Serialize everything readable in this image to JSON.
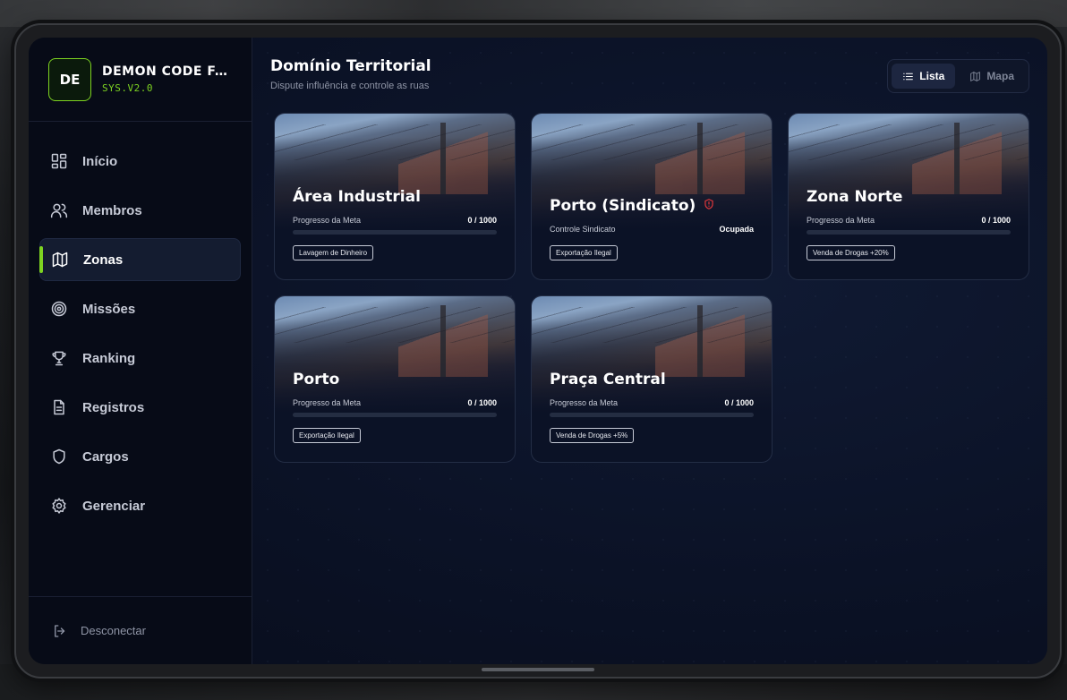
{
  "brand": {
    "logo_text": "DE",
    "name": "DEMON CODE FA...",
    "version": "SYS.V2.0",
    "accent_color": "#7dd321"
  },
  "sidebar": {
    "items": [
      {
        "label": "Início",
        "icon": "grid-icon",
        "active": false
      },
      {
        "label": "Membros",
        "icon": "users-icon",
        "active": false
      },
      {
        "label": "Zonas",
        "icon": "map-icon",
        "active": true
      },
      {
        "label": "Missões",
        "icon": "target-icon",
        "active": false
      },
      {
        "label": "Ranking",
        "icon": "trophy-icon",
        "active": false
      },
      {
        "label": "Registros",
        "icon": "document-icon",
        "active": false
      },
      {
        "label": "Cargos",
        "icon": "shield-icon",
        "active": false
      },
      {
        "label": "Gerenciar",
        "icon": "gear-icon",
        "active": false
      }
    ],
    "logout_label": "Desconectar"
  },
  "header": {
    "title": "Domínio Territorial",
    "subtitle": "Dispute influência e controle as ruas"
  },
  "view_toggle": {
    "list_label": "Lista",
    "map_label": "Mapa",
    "selected": "Lista"
  },
  "zones": [
    {
      "name": "Área Industrial",
      "status_label": "Progresso da Meta",
      "status_value": "0 / 1000",
      "progress": 0,
      "tag": "Lavagem de Dinheiro",
      "contested": false
    },
    {
      "name": "Porto (Sindicato)",
      "status_label": "Controle Sindicato",
      "status_value": "Ocupada",
      "progress": null,
      "tag": "Exportação Ilegal",
      "contested": true
    },
    {
      "name": "Zona Norte",
      "status_label": "Progresso da Meta",
      "status_value": "0 / 1000",
      "progress": 0,
      "tag": "Venda de Drogas +20%",
      "contested": false
    },
    {
      "name": "Porto",
      "status_label": "Progresso da Meta",
      "status_value": "0 / 1000",
      "progress": 0,
      "tag": "Exportação Ilegal",
      "contested": false
    },
    {
      "name": "Praça Central",
      "status_label": "Progresso da Meta",
      "status_value": "0 / 1000",
      "progress": 0,
      "tag": "Venda de Drogas +5%",
      "contested": false
    }
  ]
}
